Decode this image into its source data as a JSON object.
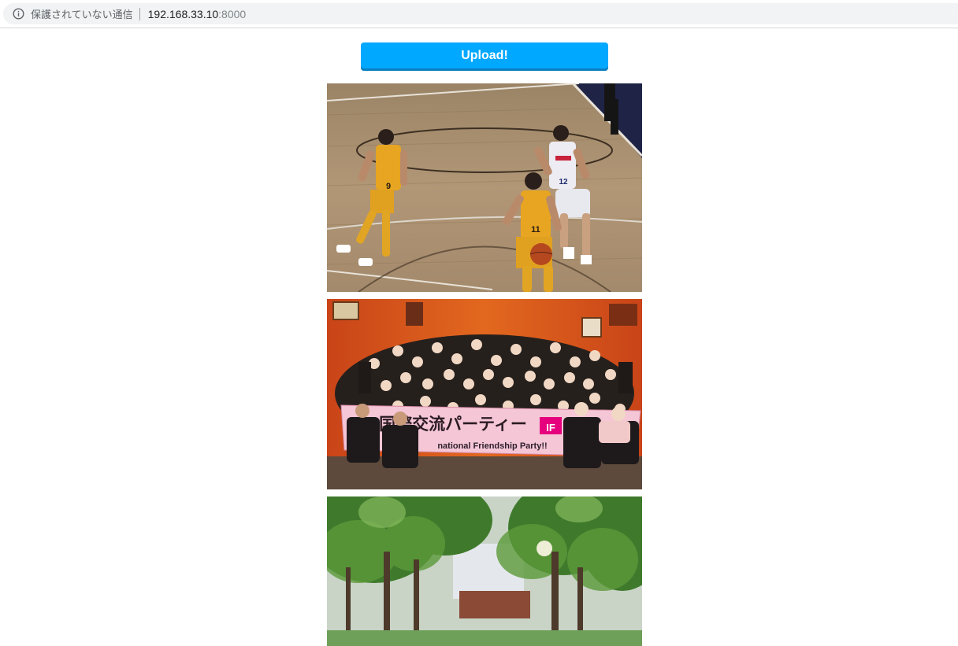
{
  "browser": {
    "security_label": "保護されていない通信",
    "url_host": "192.168.33.10",
    "url_port": ":8000",
    "info_icon": "info-circle-icon"
  },
  "page": {
    "upload_label": "Upload!",
    "accent_color": "#00a8ff"
  },
  "gallery": {
    "photos": [
      {
        "jersey_numbers": [
          "9",
          "11",
          "12"
        ]
      },
      {
        "banner_title": "国際交流パーティー",
        "banner_subtitle": "national Friendship Party!!",
        "banner_badge": "IF"
      },
      {}
    ]
  }
}
